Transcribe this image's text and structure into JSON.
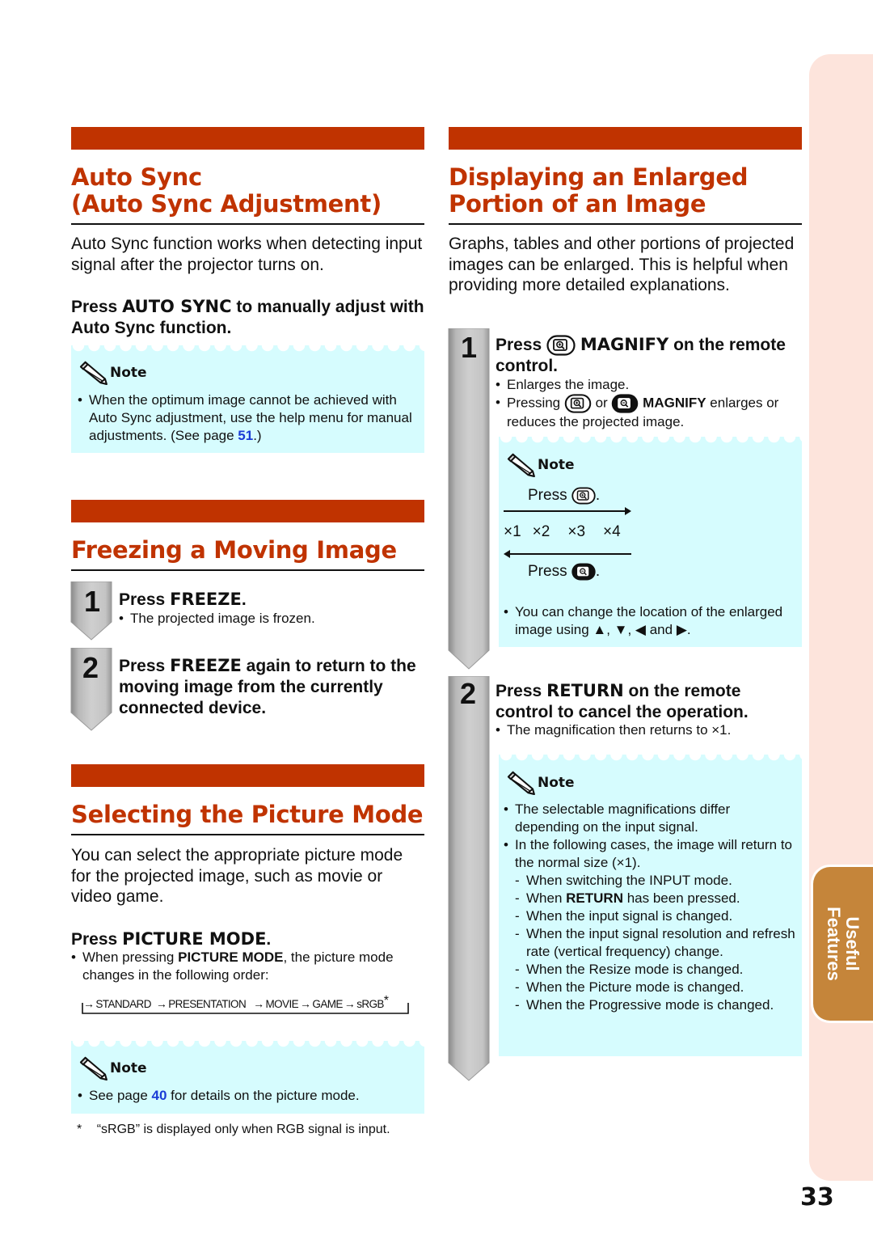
{
  "colors": {
    "accent": "#c03300",
    "note_bg": "#d6fcfe",
    "link": "#1a3cd6",
    "side_tab": "#fde4dc",
    "tab_active": "#c5853a"
  },
  "auto_sync": {
    "title_line1": "Auto Sync",
    "title_line2": "(Auto Sync Adjustment)",
    "intro": "Auto Sync function works when detecting input signal after the projector turns on.",
    "instruction_pre": "Press ",
    "instruction_key": "AUTO SYNC",
    "instruction_post": " to manually adjust with Auto Sync function.",
    "note": {
      "label": "Note",
      "text_pre": "When the optimum image cannot be achieved with Auto Sync adjustment, use the help menu for manual adjustments. (See page ",
      "page_link": "51",
      "text_post": ".)"
    }
  },
  "freeze": {
    "title": "Freezing a Moving Image",
    "steps": [
      {
        "number": "1",
        "pre": "Press ",
        "key": "FREEZE",
        "post": ".",
        "bullet": "The projected image is frozen."
      },
      {
        "number": "2",
        "pre": "Press ",
        "key": "FREEZE",
        "post": " again to return to the moving image from the currently connected device."
      }
    ]
  },
  "picture_mode": {
    "title": "Selecting the Picture Mode",
    "intro": "You can select the appropriate picture mode for the projected image, such as movie or video game.",
    "instruction_pre": "Press ",
    "instruction_key": "PICTURE MODE",
    "instruction_post": ".",
    "bullet_pre": "When pressing ",
    "bullet_key": "PICTURE MODE",
    "bullet_post": ", the picture mode changes in the following order:",
    "modes": [
      "STANDARD",
      "PRESENTATION",
      "MOVIE",
      "GAME",
      "sRGB"
    ],
    "mode_asterisk": "*",
    "note": {
      "label": "Note",
      "text_pre": "See page ",
      "page_link": "40",
      "text_post": " for details on the picture mode."
    },
    "footnote_mark": "*",
    "footnote": "“sRGB” is displayed only when RGB signal is input."
  },
  "magnify": {
    "title_line1": "Displaying an Enlarged",
    "title_line2": "Portion of an Image",
    "intro": "Graphs, tables and other portions of projected images can be enlarged. This is helpful when providing more detailed explanations.",
    "step1": {
      "number": "1",
      "pre": "Press ",
      "key": "MAGNIFY",
      "post": " on the remote control.",
      "bullet1": "Enlarges the image.",
      "bullet2_pre": "Pressing ",
      "bullet2_or": " or ",
      "bullet2_key": "MAGNIFY",
      "bullet2_post": " enlarges or reduces the projected image.",
      "note": {
        "label": "Note",
        "press_enlarge": "Press",
        "press_reduce": "Press",
        "period": ".",
        "levels": [
          "×1",
          "×2",
          "×3",
          "×4"
        ],
        "bullet": "You can change the location of the enlarged image using ▲, ▼, ◀ and ▶."
      }
    },
    "step2": {
      "number": "2",
      "pre": "Press ",
      "key": "RETURN",
      "post": " on the remote control to cancel the operation.",
      "bullet": "The magnification then returns to ×1.",
      "note": {
        "label": "Note",
        "bullets": [
          "The selectable magnifications differ depending on the input signal.",
          "In the following cases, the image will return to the normal size (×1)."
        ],
        "cases": [
          {
            "pre": "When switching the INPUT mode.",
            "key": "",
            "post": ""
          },
          {
            "pre": "When ",
            "key": "RETURN",
            "post": " has been pressed."
          },
          {
            "pre": "When the input signal is changed.",
            "key": "",
            "post": ""
          },
          {
            "pre": "When the input signal resolution and refresh rate (vertical frequency) change.",
            "key": "",
            "post": ""
          },
          {
            "pre": "When the Resize mode is changed.",
            "key": "",
            "post": ""
          },
          {
            "pre": "When the Picture mode is changed.",
            "key": "",
            "post": ""
          },
          {
            "pre": "When the Progressive mode is changed.",
            "key": "",
            "post": ""
          }
        ]
      }
    }
  },
  "side_tab": {
    "line1": "Useful",
    "line2": "Features"
  },
  "page_number": "33"
}
